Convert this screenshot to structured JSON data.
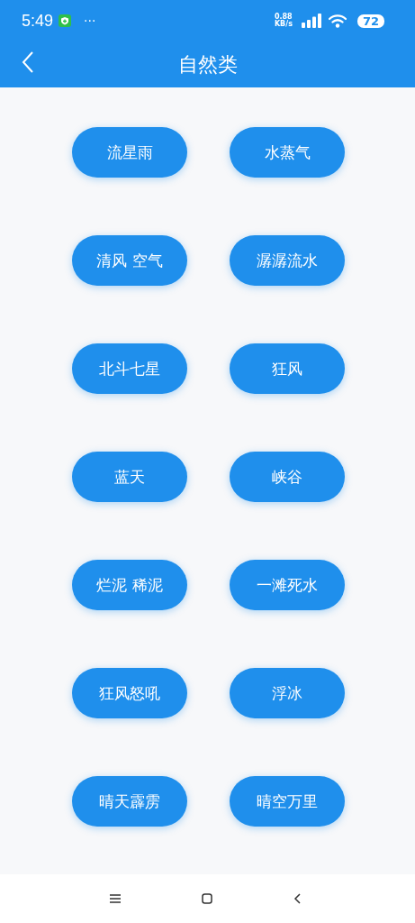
{
  "status_bar": {
    "time": "5:49",
    "more": "···",
    "speed_value": "0.88",
    "speed_unit": "KB/s",
    "battery": "72"
  },
  "header": {
    "title": "自然类"
  },
  "items": [
    {
      "label": "流星雨"
    },
    {
      "label": "水蒸气"
    },
    {
      "label": "清风 空气"
    },
    {
      "label": "潺潺流水"
    },
    {
      "label": "北斗七星"
    },
    {
      "label": "狂风"
    },
    {
      "label": "蓝天"
    },
    {
      "label": "峡谷"
    },
    {
      "label": "烂泥 稀泥"
    },
    {
      "label": "一滩死水"
    },
    {
      "label": "狂风怒吼"
    },
    {
      "label": "浮冰"
    },
    {
      "label": "晴天霹雳"
    },
    {
      "label": "晴空万里"
    }
  ]
}
